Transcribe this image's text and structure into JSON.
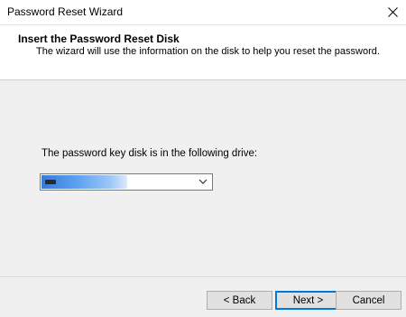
{
  "window": {
    "title": "Password Reset Wizard"
  },
  "header": {
    "title": "Insert the Password Reset Disk",
    "subtitle": "The wizard will use the information on the disk to help you reset the password."
  },
  "content": {
    "drive_label": "The password key disk is in the following drive:",
    "drive_select": {
      "selected_value": "",
      "icon": "removable-drive-icon"
    }
  },
  "buttons": {
    "back": "< Back",
    "next": "Next >",
    "cancel": "Cancel"
  },
  "colors": {
    "selection": "#3a7bd5",
    "default_button_border": "#0078d7"
  }
}
